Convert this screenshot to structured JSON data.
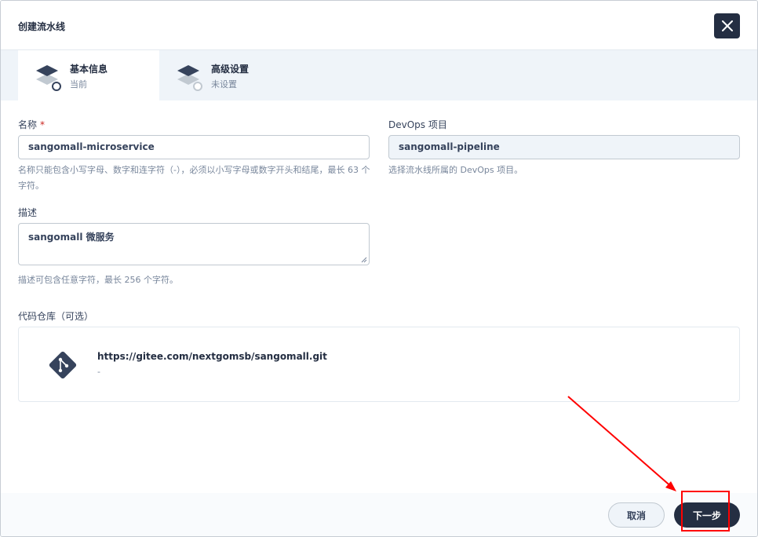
{
  "dialog": {
    "title": "创建流水线"
  },
  "steps": [
    {
      "title": "基本信息",
      "status": "当前"
    },
    {
      "title": "高级设置",
      "status": "未设置"
    }
  ],
  "form": {
    "name_label": "名称",
    "required_mark": "*",
    "name_value": "sangomall-microservice",
    "name_help": "名称只能包含小写字母、数字和连字符（-），必须以小写字母或数字开头和结尾，最长 63 个字符。",
    "project_label": "DevOps 项目",
    "project_value": "sangomall-pipeline",
    "project_help": "选择流水线所属的 DevOps 项目。",
    "desc_label": "描述",
    "desc_value": "sangomall 微服务",
    "desc_help": "描述可包含任意字符，最长 256 个字符。",
    "repo_label": "代码仓库（可选）",
    "repo_url": "https://gitee.com/nextgomsb/sangomall.git",
    "repo_sub": "-"
  },
  "footer": {
    "cancel_label": "取消",
    "next_label": "下一步"
  },
  "colors": {
    "primary_dark": "#242e42",
    "annotation": "#ff0000"
  }
}
